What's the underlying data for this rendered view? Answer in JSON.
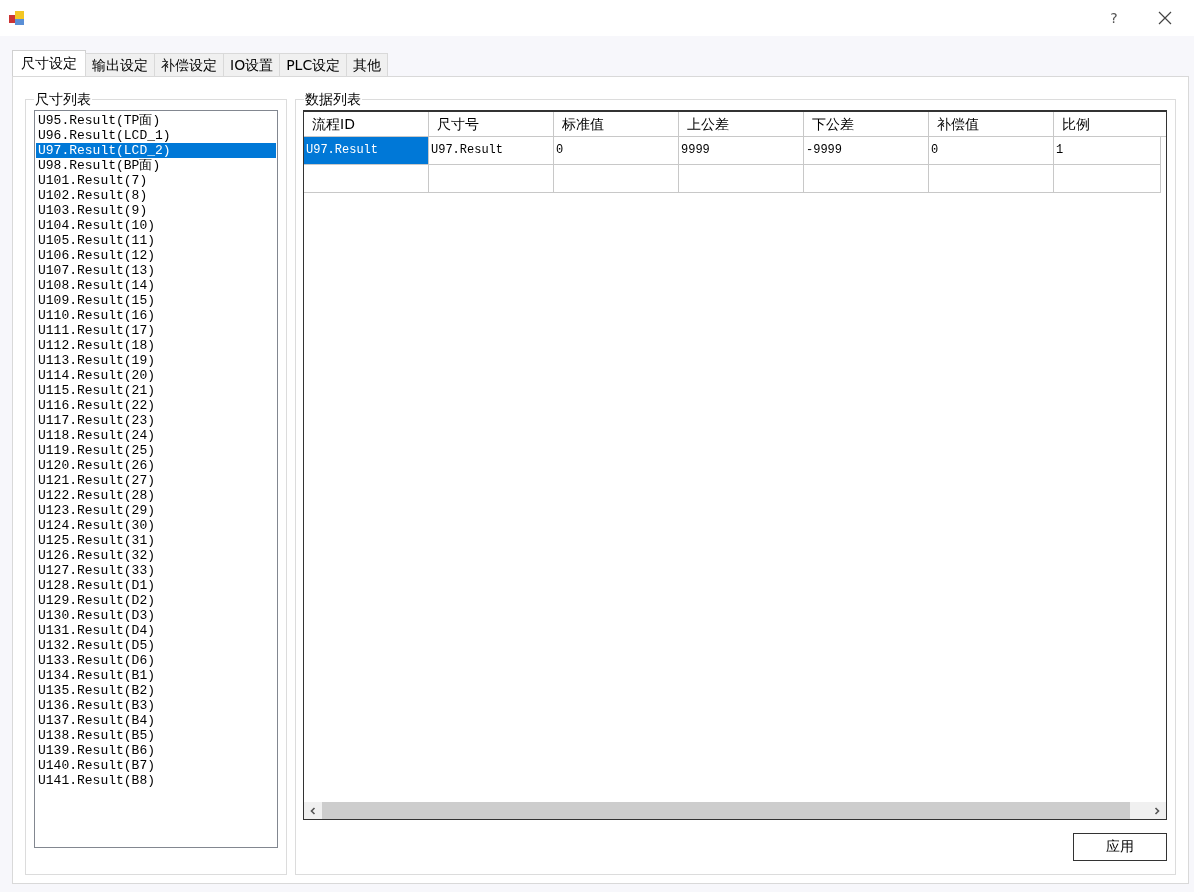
{
  "window": {
    "help_button": "?"
  },
  "tabs": [
    {
      "label": "尺寸设定",
      "selected": true
    },
    {
      "label": "输出设定",
      "selected": false
    },
    {
      "label": "补偿设定",
      "selected": false
    },
    {
      "label": "IO设置",
      "selected": false
    },
    {
      "label": "PLC设定",
      "selected": false
    },
    {
      "label": "其他",
      "selected": false
    }
  ],
  "size_list": {
    "title": "尺寸列表",
    "items": [
      {
        "label": "U95.Result(TP面)",
        "selected": false
      },
      {
        "label": "U96.Result(LCD_1)",
        "selected": false
      },
      {
        "label": "U97.Result(LCD_2)",
        "selected": true
      },
      {
        "label": "U98.Result(BP面)",
        "selected": false
      },
      {
        "label": "U101.Result(7)",
        "selected": false
      },
      {
        "label": "U102.Result(8)",
        "selected": false
      },
      {
        "label": "U103.Result(9)",
        "selected": false
      },
      {
        "label": "U104.Result(10)",
        "selected": false
      },
      {
        "label": "U105.Result(11)",
        "selected": false
      },
      {
        "label": "U106.Result(12)",
        "selected": false
      },
      {
        "label": "U107.Result(13)",
        "selected": false
      },
      {
        "label": "U108.Result(14)",
        "selected": false
      },
      {
        "label": "U109.Result(15)",
        "selected": false
      },
      {
        "label": "U110.Result(16)",
        "selected": false
      },
      {
        "label": "U111.Result(17)",
        "selected": false
      },
      {
        "label": "U112.Result(18)",
        "selected": false
      },
      {
        "label": "U113.Result(19)",
        "selected": false
      },
      {
        "label": "U114.Result(20)",
        "selected": false
      },
      {
        "label": "U115.Result(21)",
        "selected": false
      },
      {
        "label": "U116.Result(22)",
        "selected": false
      },
      {
        "label": "U117.Result(23)",
        "selected": false
      },
      {
        "label": "U118.Result(24)",
        "selected": false
      },
      {
        "label": "U119.Result(25)",
        "selected": false
      },
      {
        "label": "U120.Result(26)",
        "selected": false
      },
      {
        "label": "U121.Result(27)",
        "selected": false
      },
      {
        "label": "U122.Result(28)",
        "selected": false
      },
      {
        "label": "U123.Result(29)",
        "selected": false
      },
      {
        "label": "U124.Result(30)",
        "selected": false
      },
      {
        "label": "U125.Result(31)",
        "selected": false
      },
      {
        "label": "U126.Result(32)",
        "selected": false
      },
      {
        "label": "U127.Result(33)",
        "selected": false
      },
      {
        "label": "U128.Result(D1)",
        "selected": false
      },
      {
        "label": "U129.Result(D2)",
        "selected": false
      },
      {
        "label": "U130.Result(D3)",
        "selected": false
      },
      {
        "label": "U131.Result(D4)",
        "selected": false
      },
      {
        "label": "U132.Result(D5)",
        "selected": false
      },
      {
        "label": "U133.Result(D6)",
        "selected": false
      },
      {
        "label": "U134.Result(B1)",
        "selected": false
      },
      {
        "label": "U135.Result(B2)",
        "selected": false
      },
      {
        "label": "U136.Result(B3)",
        "selected": false
      },
      {
        "label": "U137.Result(B4)",
        "selected": false
      },
      {
        "label": "U138.Result(B5)",
        "selected": false
      },
      {
        "label": "U139.Result(B6)",
        "selected": false
      },
      {
        "label": "U140.Result(B7)",
        "selected": false
      },
      {
        "label": "U141.Result(B8)",
        "selected": false
      }
    ]
  },
  "data_table": {
    "title": "数据列表",
    "columns": [
      "流程ID",
      "尺寸号",
      "标准值",
      "上公差",
      "下公差",
      "补偿值",
      "比例"
    ],
    "rows": [
      {
        "cells": [
          {
            "text": "U97.Result",
            "selected": true
          },
          {
            "text": "U97.Result",
            "selected": false
          },
          {
            "text": "0",
            "selected": false
          },
          {
            "text": "9999",
            "selected": false
          },
          {
            "text": "-9999",
            "selected": false
          },
          {
            "text": "0",
            "selected": false
          },
          {
            "text": "1",
            "selected": false
          }
        ]
      }
    ],
    "new_row": true
  },
  "apply_button": "应用"
}
